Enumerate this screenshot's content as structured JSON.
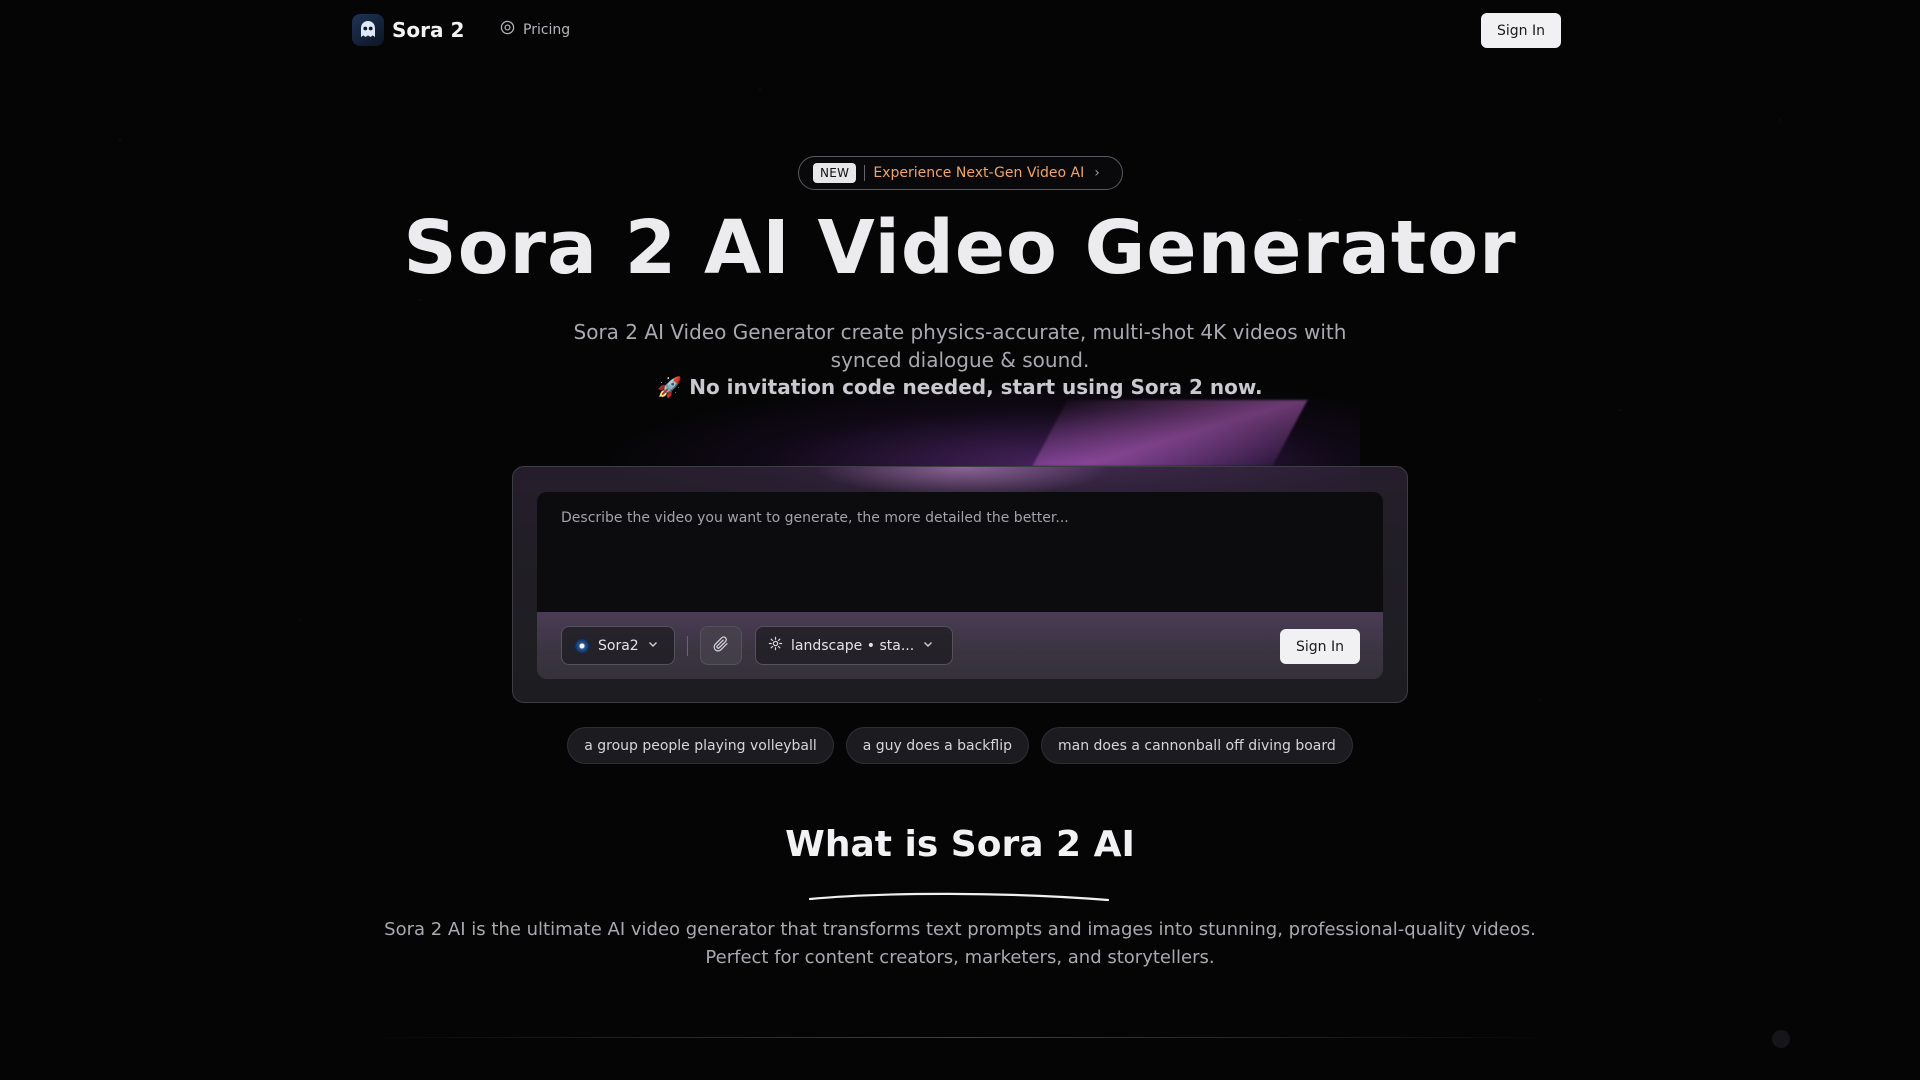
{
  "nav": {
    "brand_name": "Sora 2",
    "pricing_label": "Pricing",
    "sign_in_label": "Sign In"
  },
  "hero": {
    "badge_tag": "NEW",
    "badge_text": "Experience Next-Gen Video AI",
    "title": "Sora 2 AI Video Generator",
    "subtitle": "Sora 2 AI Video Generator create physics-accurate, multi-shot 4K videos with synced dialogue & sound.",
    "cta_emoji": "🚀",
    "cta_text": "No invitation code needed, start using Sora 2 now."
  },
  "generator": {
    "prompt_placeholder": "Describe the video you want to generate, the more detailed the better...",
    "prompt_value": "",
    "model_label": "Sora2",
    "settings_label": "landscape • sta...",
    "sign_in_label": "Sign In"
  },
  "suggestions": [
    "a group people playing volleyball",
    "a guy does a backflip",
    "man does a cannonball off diving board"
  ],
  "what_is": {
    "title": "What is Sora 2 AI",
    "text": "Sora 2 AI is the ultimate AI video generator that transforms text prompts and images into stunning, professional-quality videos. Perfect for content creators, marketers, and storytellers."
  },
  "icons": {
    "brand": "ghost-logo-icon",
    "pricing": "coin-icon",
    "model": "sora-model-icon",
    "attach": "paperclip-icon",
    "settings": "gear-icon",
    "chevron": "chevron-down-icon"
  },
  "colors": {
    "background": "#050506",
    "badge_accent": "#f0a466",
    "button_bg": "#f1f1f3",
    "glow": "#9646c8"
  }
}
